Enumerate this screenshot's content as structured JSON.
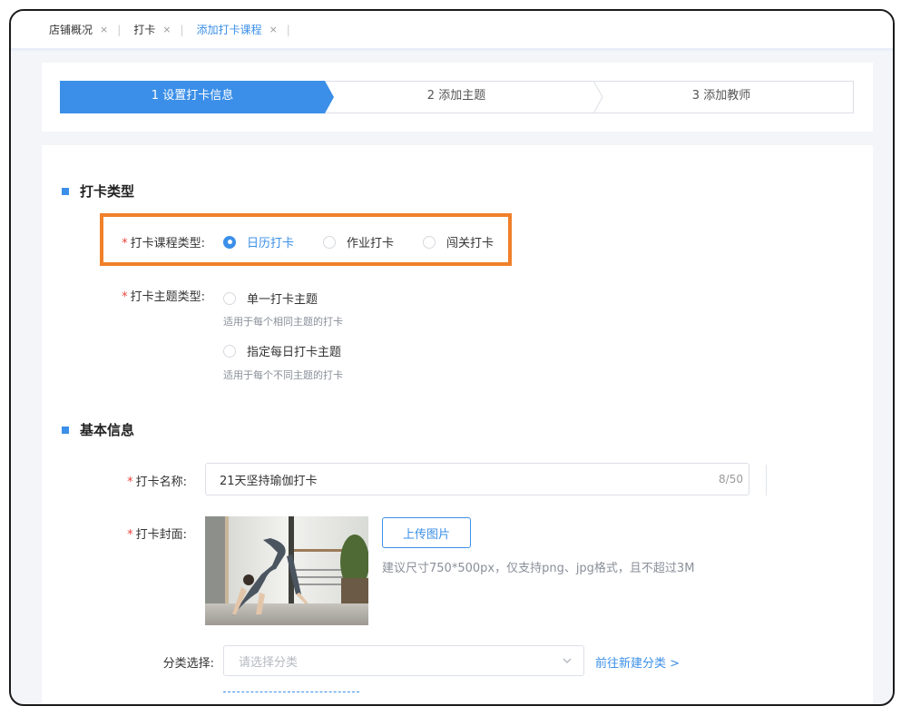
{
  "tabs": [
    {
      "label": "店铺概况",
      "close": "×",
      "active": false
    },
    {
      "label": "打卡",
      "close": "×",
      "active": false
    },
    {
      "label": "添加打卡课程",
      "close": "×",
      "active": true
    }
  ],
  "tab_separator": "|",
  "steps": [
    {
      "label": "1 设置打卡信息",
      "active": true
    },
    {
      "label": "2 添加主题",
      "active": false
    },
    {
      "label": "3 添加教师",
      "active": false
    }
  ],
  "sections": {
    "checkin_type": {
      "title": "打卡类型",
      "course_type": {
        "required_mark": "*",
        "label": "打卡课程类型:",
        "options": [
          {
            "label": "日历打卡",
            "checked": true
          },
          {
            "label": "作业打卡",
            "checked": false
          },
          {
            "label": "闯关打卡",
            "checked": false
          }
        ]
      },
      "theme_type": {
        "required_mark": "*",
        "label": "打卡主题类型:",
        "options": [
          {
            "label": "单一打卡主题",
            "hint": "适用于每个相同主题的打卡",
            "checked": false
          },
          {
            "label": "指定每日打卡主题",
            "hint": "适用于每个不同主题的打卡",
            "checked": false
          }
        ]
      }
    },
    "basic_info": {
      "title": "基本信息",
      "name": {
        "required_mark": "*",
        "label": "打卡名称:",
        "value": "21天坚持瑜伽打卡",
        "counter": "8/50"
      },
      "cover": {
        "required_mark": "*",
        "label": "打卡封面:",
        "upload_label": "上传图片",
        "hint": "建议尺寸750*500px，仅支持png、jpg格式，且不超过3M"
      },
      "category": {
        "label": "分类选择:",
        "placeholder": "请选择分类",
        "link": "前往新建分类 >"
      }
    }
  },
  "colors": {
    "accent": "#3b8fe8",
    "highlight": "#f0802a",
    "required": "#e8443b"
  }
}
